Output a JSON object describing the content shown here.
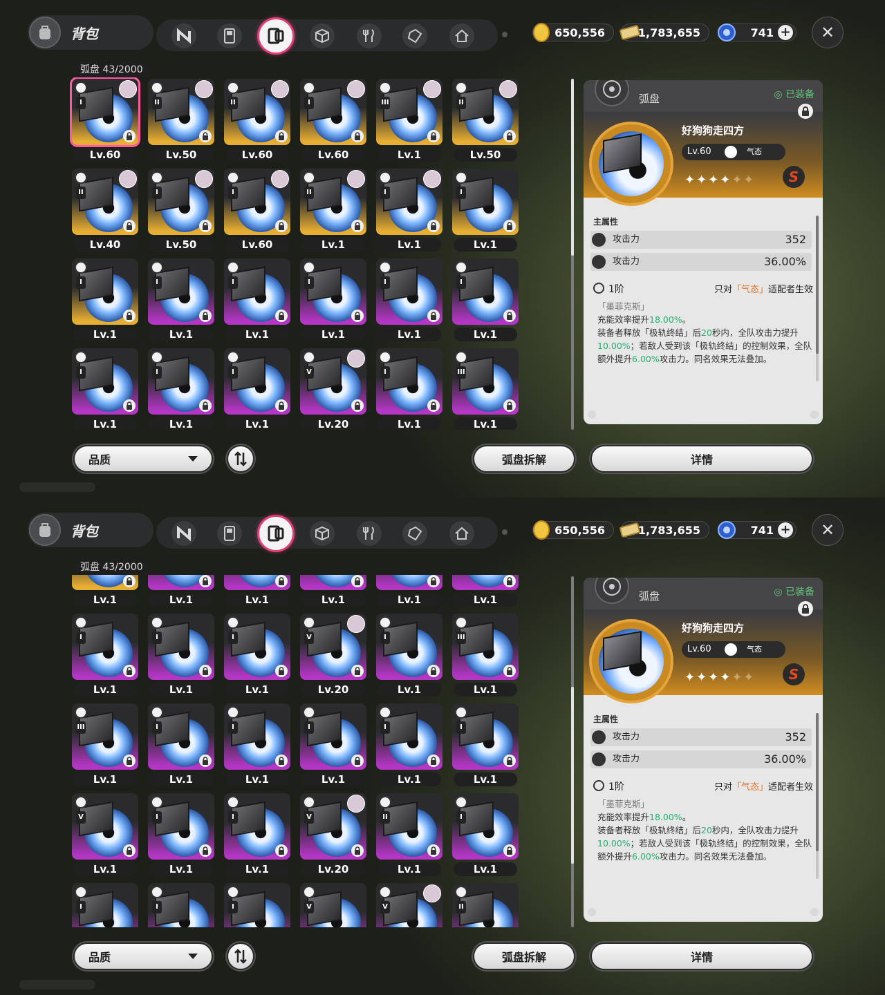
{
  "header": {
    "bag_title": "背包"
  },
  "tabs": [
    "n-logo-icon",
    "gameboy-icon",
    "disc-drive-icon",
    "cube-icon",
    "fork-knife-icon",
    "card-pack-icon",
    "home-icon"
  ],
  "currency": {
    "coin": "650,556",
    "ticket": "1,783,655",
    "gem": "741",
    "plus": "+"
  },
  "grid": {
    "count": "弧盘 43/2000"
  },
  "detail": {
    "tab_title": "弧盘",
    "equipped": "◎ 已装备",
    "name": "好狗狗走四方",
    "level": "Lv.60",
    "attr_type": "气态",
    "stars": "✦✦✦✦",
    "stars_dim": "✦✦",
    "rank": "S",
    "main_stat_title": "主属性",
    "stats": [
      {
        "name": "攻击力",
        "value": "352"
      },
      {
        "name": "攻击力",
        "value": "36.00%"
      }
    ],
    "tier": "1阶",
    "only_pre": "只对",
    "only_hl": "「气态」",
    "only_post": "适配者生效",
    "set_name": "「墨菲克斯」",
    "desc1_a": "充能效率提升",
    "desc1_b": "18.00%",
    "desc1_c": "。",
    "desc2_a": "装备者释放「极轨终结」后",
    "desc2_b": "20",
    "desc2_c": "秒内，全队攻击力提升",
    "desc2_d": "10.00%",
    "desc2_e": "；若敌人受到该「极轨终结」的控制效果，全队额外提升",
    "desc2_f": "6.00%",
    "desc2_g": "攻击力。同名效果无法叠加。"
  },
  "buttons": {
    "quality": "品质",
    "dismantle": "弧盘拆解",
    "details": "详情"
  },
  "panel1_cards": [
    {
      "lv": "Lv.60",
      "rank": "I",
      "q": "gold",
      "av": true,
      "sel": true
    },
    {
      "lv": "Lv.50",
      "rank": "II",
      "q": "gold",
      "av": true
    },
    {
      "lv": "Lv.60",
      "rank": "II",
      "q": "gold",
      "av": true
    },
    {
      "lv": "Lv.60",
      "rank": "I",
      "q": "gold",
      "av": true
    },
    {
      "lv": "Lv.1",
      "rank": "III",
      "q": "gold",
      "av": true
    },
    {
      "lv": "Lv.50",
      "rank": "II",
      "q": "gold",
      "av": true
    },
    {
      "lv": "Lv.40",
      "rank": "II",
      "q": "gold",
      "av": true
    },
    {
      "lv": "Lv.50",
      "rank": "I",
      "q": "gold",
      "av": true
    },
    {
      "lv": "Lv.60",
      "rank": "I",
      "q": "gold",
      "av": true
    },
    {
      "lv": "Lv.1",
      "rank": "II",
      "q": "gold",
      "av": true
    },
    {
      "lv": "Lv.1",
      "rank": "I",
      "q": "gold",
      "av": true
    },
    {
      "lv": "Lv.1",
      "rank": "I",
      "q": "gold"
    },
    {
      "lv": "Lv.1",
      "rank": "I",
      "q": "gold"
    },
    {
      "lv": "Lv.1",
      "rank": "I",
      "q": "purple"
    },
    {
      "lv": "Lv.1",
      "rank": "I",
      "q": "purple"
    },
    {
      "lv": "Lv.1",
      "rank": "I",
      "q": "purple"
    },
    {
      "lv": "Lv.1",
      "rank": "I",
      "q": "purple"
    },
    {
      "lv": "Lv.1",
      "rank": "I",
      "q": "purple"
    },
    {
      "lv": "Lv.1",
      "rank": "I",
      "q": "purple"
    },
    {
      "lv": "Lv.1",
      "rank": "I",
      "q": "purple"
    },
    {
      "lv": "Lv.1",
      "rank": "I",
      "q": "purple"
    },
    {
      "lv": "Lv.20",
      "rank": "V",
      "q": "purple",
      "av": true
    },
    {
      "lv": "Lv.1",
      "rank": "I",
      "q": "purple"
    },
    {
      "lv": "Lv.1",
      "rank": "III",
      "q": "purple"
    }
  ],
  "panel2_cards": [
    {
      "lv": "Lv.1",
      "rank": "",
      "q": "gold"
    },
    {
      "lv": "Lv.1",
      "rank": "",
      "q": "purple"
    },
    {
      "lv": "Lv.1",
      "rank": "",
      "q": "purple"
    },
    {
      "lv": "Lv.1",
      "rank": "",
      "q": "purple"
    },
    {
      "lv": "Lv.1",
      "rank": "",
      "q": "purple"
    },
    {
      "lv": "Lv.1",
      "rank": "",
      "q": "purple"
    },
    {
      "lv": "Lv.1",
      "rank": "I",
      "q": "purple"
    },
    {
      "lv": "Lv.1",
      "rank": "I",
      "q": "purple"
    },
    {
      "lv": "Lv.1",
      "rank": "I",
      "q": "purple"
    },
    {
      "lv": "Lv.20",
      "rank": "V",
      "q": "purple",
      "av": true
    },
    {
      "lv": "Lv.1",
      "rank": "I",
      "q": "purple"
    },
    {
      "lv": "Lv.1",
      "rank": "III",
      "q": "purple"
    },
    {
      "lv": "Lv.1",
      "rank": "III",
      "q": "purple"
    },
    {
      "lv": "Lv.1",
      "rank": "I",
      "q": "purple"
    },
    {
      "lv": "Lv.1",
      "rank": "I",
      "q": "purple"
    },
    {
      "lv": "Lv.1",
      "rank": "I",
      "q": "purple"
    },
    {
      "lv": "Lv.1",
      "rank": "I",
      "q": "purple"
    },
    {
      "lv": "Lv.1",
      "rank": "I",
      "q": "purple"
    },
    {
      "lv": "Lv.1",
      "rank": "V",
      "q": "purple"
    },
    {
      "lv": "Lv.1",
      "rank": "I",
      "q": "purple"
    },
    {
      "lv": "Lv.1",
      "rank": "I",
      "q": "purple"
    },
    {
      "lv": "Lv.20",
      "rank": "V",
      "q": "purple",
      "av": true
    },
    {
      "lv": "Lv.1",
      "rank": "II",
      "q": "purple"
    },
    {
      "lv": "Lv.1",
      "rank": "I",
      "q": "purple"
    },
    {
      "lv": "",
      "rank": "I",
      "q": "purple"
    },
    {
      "lv": "",
      "rank": "I",
      "q": "purple"
    },
    {
      "lv": "",
      "rank": "I",
      "q": "purple"
    },
    {
      "lv": "",
      "rank": "V",
      "q": "purple"
    },
    {
      "lv": "",
      "rank": "V",
      "q": "purple",
      "av": true
    },
    {
      "lv": "",
      "rank": "II",
      "q": "purple"
    }
  ],
  "colors": {
    "accent": "#e0407a",
    "gold": "#e6ae33",
    "purple": "#b336c4",
    "equipped": "#66c27e",
    "highlight": "#e3762b",
    "value_green": "#22b070"
  }
}
